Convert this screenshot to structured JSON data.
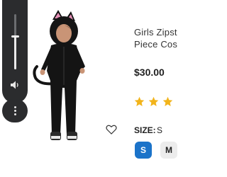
{
  "product": {
    "title_line1": "Girls Zipst",
    "title_line2": "Piece Cos",
    "price": "$30.00",
    "rating": {
      "filled": 3,
      "visible": 3
    },
    "size_label": "SIZE:",
    "size_value": "S",
    "size_options": [
      "S",
      "M"
    ],
    "selected_size": "S"
  },
  "volume": {
    "level": 0.6,
    "icon": "speaker-icon",
    "more_icon": "more-vert-icon"
  },
  "colors": {
    "accent": "#1b73c9",
    "star": "#f2b41b",
    "panel": "#2b2c2e"
  }
}
